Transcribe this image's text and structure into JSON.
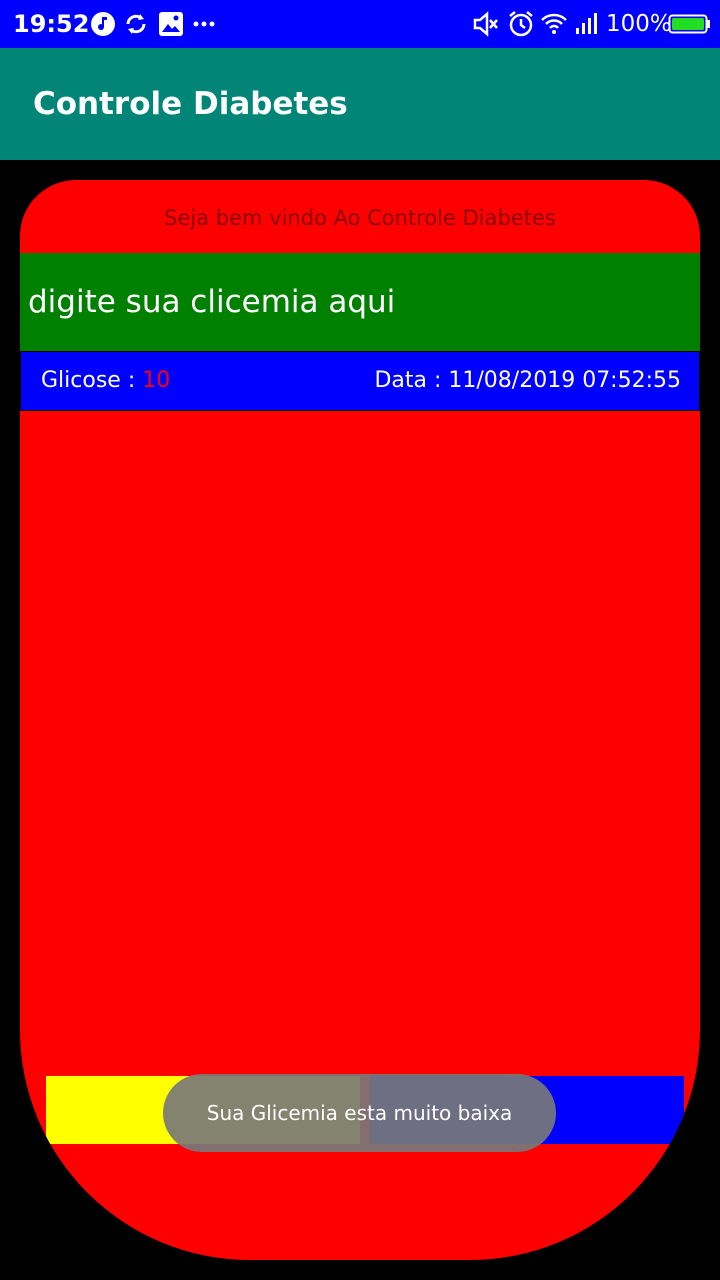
{
  "status_bar": {
    "time": "19:52",
    "battery": "100%",
    "icons": [
      "music-note-icon",
      "sync-icon",
      "image-icon",
      "more-dots-icon",
      "mute-icon",
      "alarm-icon",
      "wifi-icon",
      "signal-icon",
      "battery-icon"
    ]
  },
  "app_bar": {
    "title": "Controle Diabetes"
  },
  "main": {
    "welcome": "Seja bem vindo Ao Controle Diabetes",
    "input_placeholder": "digite sua clicemia aqui",
    "record": {
      "glicose_label": "Glicose :",
      "glicose_value": "10",
      "date_text": "Data : 11/08/2019 07:52:55"
    }
  },
  "toast": {
    "message": "Sua Glicemia esta muito  baixa"
  },
  "colors": {
    "status_bar": "#0000ff",
    "app_bar": "#008577",
    "panel": "#ff0000",
    "input_bg": "#008000",
    "record_bg": "#0000ff",
    "button_left": "#ffff00",
    "button_right": "#0000ff"
  }
}
